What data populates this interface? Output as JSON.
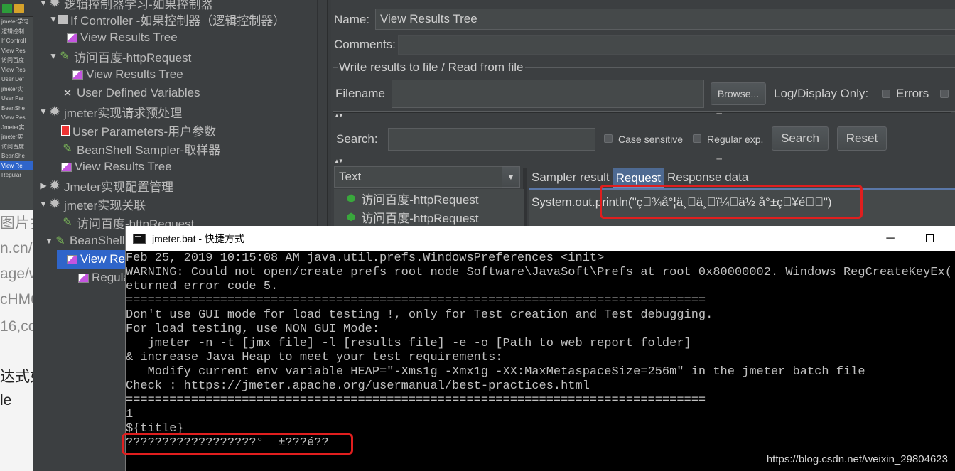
{
  "blog": {
    "fragments": [
      "图片扌",
      "n.cn/2",
      "age/w",
      "cHM6",
      "16,cc",
      "达式如",
      "le"
    ]
  },
  "mini_tree": {
    "items": [
      "jmeter学习",
      "逻辑控制",
      "If Controll",
      "View Res",
      "访问百度",
      "View Res",
      "User Def",
      "jmeter实",
      "User Par",
      "BeanShe",
      "View Res",
      "Jmeter实",
      "jmeter实",
      "访问百度",
      "BeanShe",
      "View Re",
      "Regular"
    ]
  },
  "tree": {
    "top_partial": "逻辑控制器学习-如果控制器",
    "nodes": [
      {
        "label": "If Controller  -如果控制器（逻辑控制器）",
        "icon": "controller-icon"
      },
      {
        "label": "View Results Tree",
        "icon": "listener-icon"
      },
      {
        "label": "访问百度-httpRequest",
        "icon": "sampler-icon"
      },
      {
        "label": "View Results Tree",
        "icon": "listener-icon"
      },
      {
        "label": "User Defined Variables",
        "icon": "wrench-icon"
      },
      {
        "label": "jmeter实现请求预处理",
        "icon": "gear-icon"
      },
      {
        "label": "User Parameters-用户参数",
        "icon": "preprocessor-icon"
      },
      {
        "label": "BeanShell Sampler-取样器",
        "icon": "sampler-icon"
      },
      {
        "label": "View Results Tree",
        "icon": "listener-icon"
      },
      {
        "label": "Jmeter实现配置管理",
        "icon": "gear-icon"
      },
      {
        "label": "jmeter实现关联",
        "icon": "gear-icon"
      },
      {
        "label": "访问百度-httpRequest",
        "icon": "sampler-icon"
      },
      {
        "label": "BeanShell",
        "icon": "sampler-icon"
      },
      {
        "label": "View Re",
        "icon": "listener-icon"
      },
      {
        "label": "Regular E",
        "icon": "extractor-icon"
      }
    ]
  },
  "panel": {
    "name_label": "Name:",
    "name_value": "View Results Tree",
    "comments_label": "Comments:",
    "file_group_title": "Write results to file / Read from file",
    "filename_label": "Filename",
    "browse_label": "Browse...",
    "log_display_label": "Log/Display Only:",
    "errors_label": "Errors",
    "search_label": "Search:",
    "case_sensitive_label": "Case sensitive",
    "regular_exp_label": "Regular exp.",
    "search_button": "Search",
    "reset_button": "Reset",
    "renderer_value": "Text",
    "results": [
      "访问百度-httpRequest",
      "访问百度-httpRequest"
    ],
    "tabs": [
      "Sampler result",
      "Request",
      "Response data"
    ],
    "active_tab": "Request",
    "request_text": "System.out.println(\"ç\u0000¾å°¦ä¸\u0000ä¸\u0000ï¼\u0000ä½ å°±ç\u0000¥é\u0000\u0000\")"
  },
  "console": {
    "title": "jmeter.bat - 快捷方式",
    "lines": [
      "Feb 25, 2019 10:15:08 AM java.util.prefs.WindowsPreferences <init>",
      "WARNING: Could not open/create prefs root node Software\\JavaSoft\\Prefs at root 0x80000002. Windows RegCreateKeyEx(...",
      "eturned error code 5.",
      "================================================================================",
      "Don't use GUI mode for load testing !, only for Test creation and Test debugging.",
      "For load testing, use NON GUI Mode:",
      "   jmeter -n -t [jmx file] -l [results file] -e -o [Path to web report folder]",
      "& increase Java Heap to meet your test requirements:",
      "   Modify current env variable HEAP=\"-Xms1g -Xmx1g -XX:MaxMetaspaceSize=256m\" in the jmeter batch file",
      "Check : https://jmeter.apache.org/usermanual/best-practices.html",
      "================================================================================",
      "1",
      "${title}",
      "??????????????????°  ±???é??"
    ]
  },
  "watermark": "https://blog.csdn.net/weixin_29804623",
  "colors": {
    "selection": "#2f65ca",
    "highlight_box": "#e01e1e",
    "active_tab": "#4e6a92"
  }
}
